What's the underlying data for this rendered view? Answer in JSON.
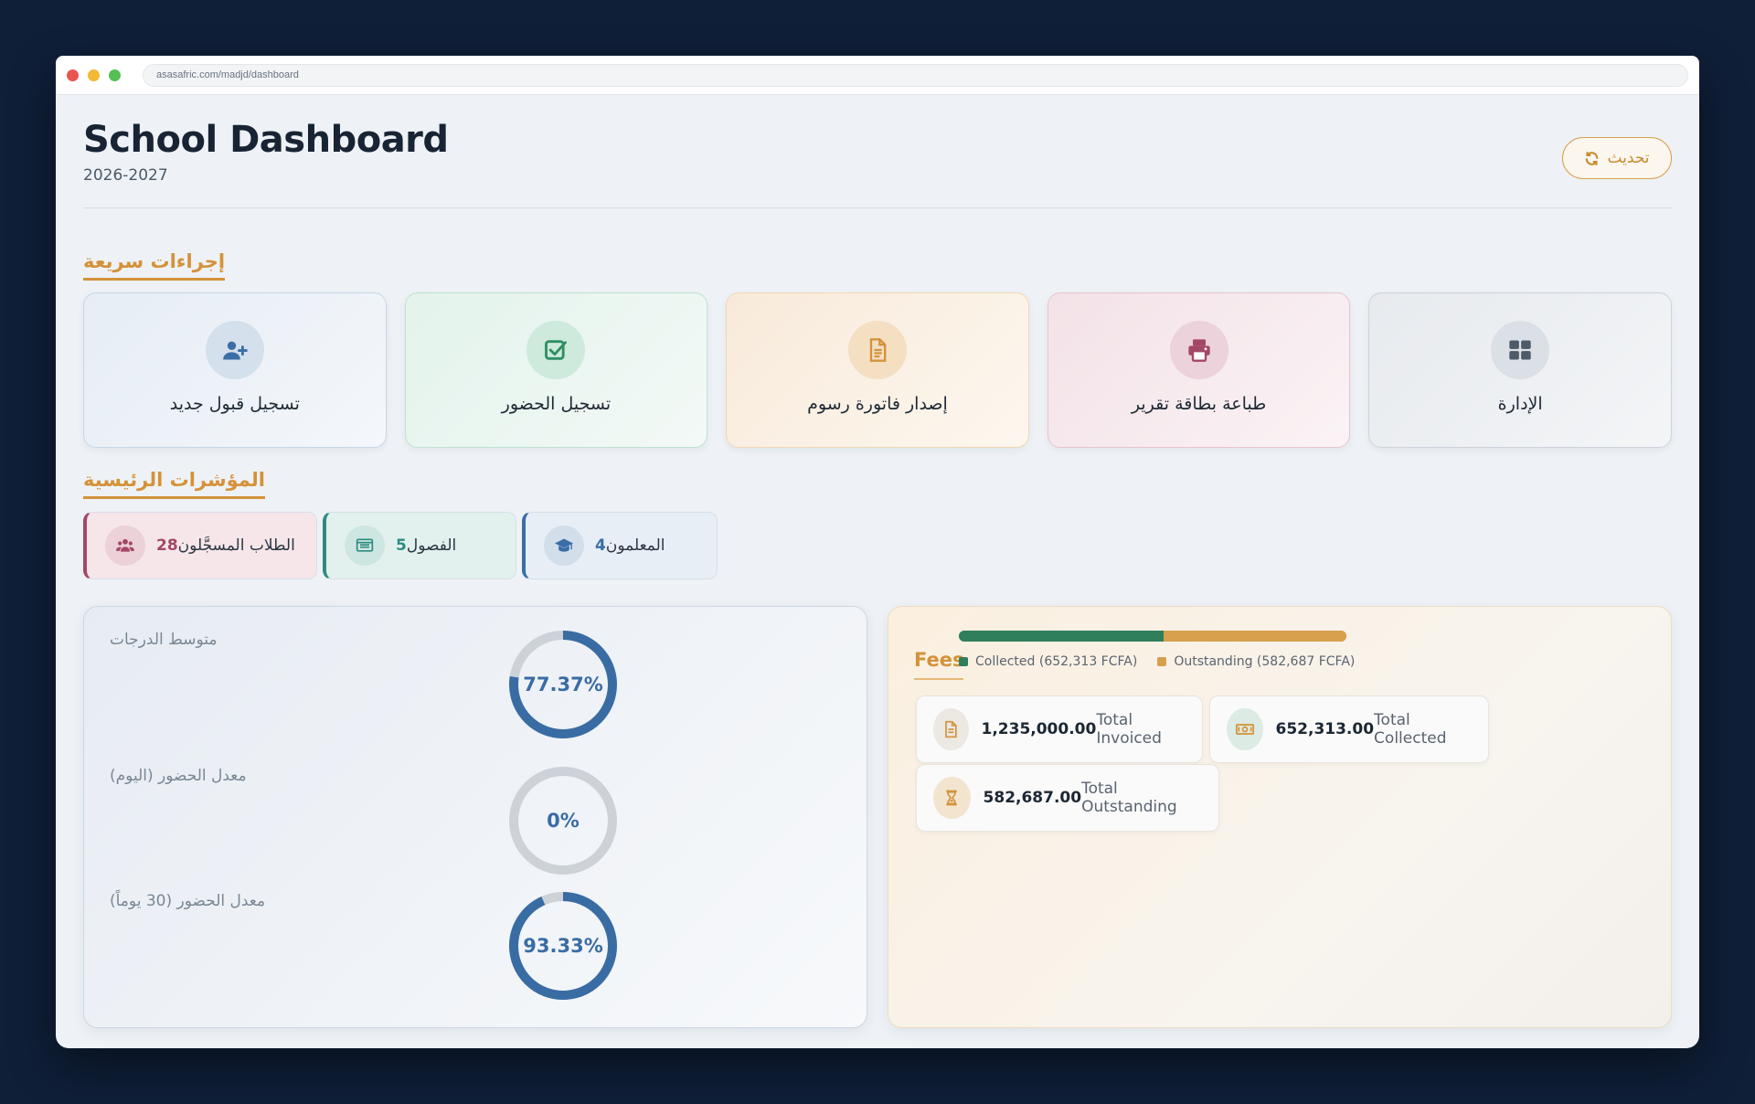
{
  "browser": {
    "url": "asasafric.com/madjd/dashboard"
  },
  "header": {
    "title": "School Dashboard",
    "subtitle": "2026-2027",
    "refresh_label": "تحديث"
  },
  "quick_actions": {
    "title": "إجراءات سريعة",
    "items": [
      {
        "label": "تسجيل قبول جديد",
        "icon": "user-plus-icon"
      },
      {
        "label": "تسجيل الحضور",
        "icon": "check-square-icon"
      },
      {
        "label": "إصدار فاتورة رسوم",
        "icon": "file-invoice-icon"
      },
      {
        "label": "طباعة بطاقة تقرير",
        "icon": "printer-icon"
      },
      {
        "label": "الإدارة",
        "icon": "grid-icon"
      }
    ]
  },
  "kpis": {
    "title": "المؤشرات الرئيسية",
    "items": [
      {
        "value": "28",
        "label": "الطلاب المسجَّلون",
        "icon": "users-icon",
        "color": "#a34766"
      },
      {
        "value": "5",
        "label": "الفصول",
        "icon": "classroom-icon",
        "color": "#2e8b83"
      },
      {
        "value": "4",
        "label": "المعلمون",
        "icon": "graduation-cap-icon",
        "color": "#3b6ea6"
      }
    ]
  },
  "performance": {
    "metrics": [
      {
        "label": "متوسط الدرجات",
        "value_text": "77.37%",
        "percent": 77.37
      },
      {
        "label": "معدل الحضور (اليوم)",
        "value_text": "0%",
        "percent": 0
      },
      {
        "label": "معدل الحضور (30 يوماً)",
        "value_text": "93.33%",
        "percent": 93.33
      }
    ],
    "gauge_color": "#3a6ca4",
    "track_color": "#cdd2d8"
  },
  "fees": {
    "title": "Fees",
    "collected_share": 52.8,
    "legend": [
      {
        "label": "Collected (652,313 FCFA)",
        "color": "#2f7e5c"
      },
      {
        "label": "Outstanding (582,687 FCFA)",
        "color": "#d8a04c"
      }
    ],
    "cards": [
      {
        "value": "1,235,000.00",
        "label": "Total Invoiced",
        "icon": "document-icon"
      },
      {
        "value": "652,313.00",
        "label": "Total Collected",
        "icon": "banknote-icon"
      },
      {
        "value": "582,687.00",
        "label": "Total Outstanding",
        "icon": "hourglass-icon"
      }
    ]
  }
}
